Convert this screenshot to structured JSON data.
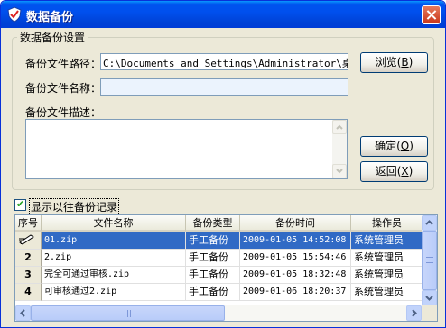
{
  "window": {
    "title": "数据备份",
    "icon": "shield-check-icon"
  },
  "settings": {
    "legend": "数据备份设置",
    "path_label": "备份文件路径：",
    "path_value": "C:\\Documents and Settings\\Administrator\\桌面",
    "name_label": "备份文件名称：",
    "name_value": "",
    "desc_label": "备份文件描述：",
    "desc_value": ""
  },
  "buttons": {
    "browse": {
      "text": "浏览",
      "key": "B"
    },
    "ok": {
      "text": "确定",
      "key": "O"
    },
    "back": {
      "text": "返回",
      "key": "X"
    }
  },
  "history_toggle": {
    "label": "显示以往备份记录",
    "checked": true
  },
  "table": {
    "columns": [
      "序号",
      "文件名称",
      "备份类型",
      "备份时间",
      "操作员"
    ],
    "rows": [
      {
        "idx": "",
        "file": "01.zip",
        "type": "手工备份",
        "time": "2009-01-05 14:52:08",
        "operator": "系统管理员",
        "selected": true
      },
      {
        "idx": "2",
        "file": "2.zip",
        "type": "手工备份",
        "time": "2009-01-05 15:54:46",
        "operator": "系统管理员"
      },
      {
        "idx": "3",
        "file": "完全可通过审核.zip",
        "type": "手工备份",
        "time": "2009-01-05 18:32:48",
        "operator": "系统管理员"
      },
      {
        "idx": "4",
        "file": "可审核通过2.zip",
        "type": "手工备份",
        "time": "2009-01-06 18:20:37",
        "operator": "系统管理员"
      }
    ],
    "current_row_icon": "pencil-edit-icon"
  },
  "colors": {
    "title_bar": "#0053ee",
    "selection": "#316ac5",
    "dialog_bg": "#ece9d8"
  }
}
